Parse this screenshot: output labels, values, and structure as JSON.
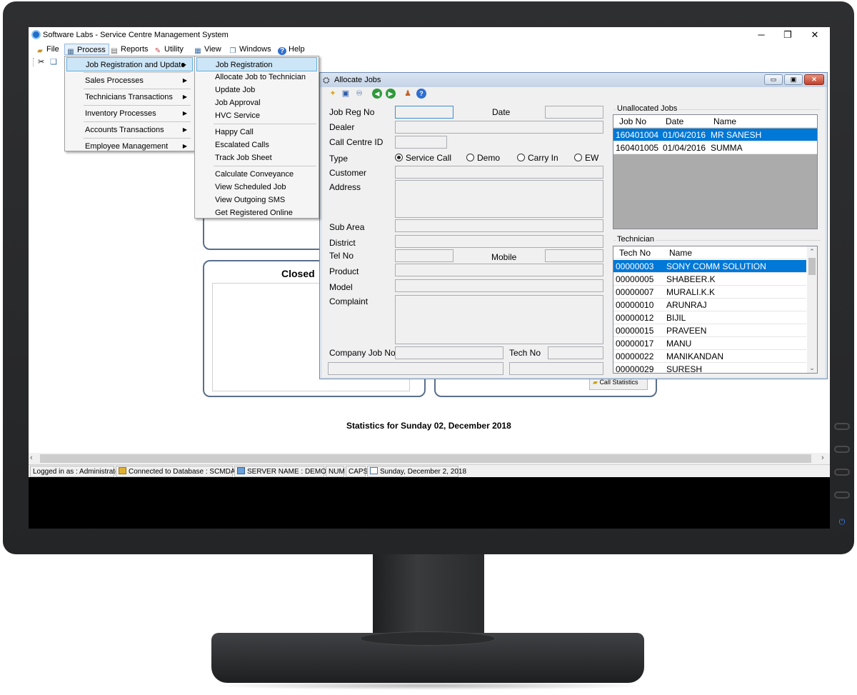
{
  "app": {
    "title": "Software Labs - Service Centre Management System",
    "controls": {
      "minimize": "─",
      "restore": "❐",
      "close": "✕"
    }
  },
  "menubar": {
    "items": [
      {
        "label": "File",
        "icon": "folder-icon"
      },
      {
        "label": "Process",
        "icon": "process-icon"
      },
      {
        "label": "Reports",
        "icon": "report-icon"
      },
      {
        "label": "Utility",
        "icon": "wrench-icon"
      },
      {
        "label": "View",
        "icon": "grid-icon"
      },
      {
        "label": "Windows",
        "icon": "windows-icon"
      },
      {
        "label": "Help",
        "icon": "help-icon"
      }
    ]
  },
  "process_menu": {
    "items": [
      {
        "label": "Job Registration and Update"
      },
      {
        "label": "Sales Processes"
      },
      {
        "label": "Technicians Transactions"
      },
      {
        "label": "Inventory Processes"
      },
      {
        "label": "Accounts Transactions"
      },
      {
        "label": "Employee Management"
      }
    ]
  },
  "submenu": {
    "items": [
      {
        "label": "Job Registration"
      },
      {
        "label": "Allocate Job to Technician"
      },
      {
        "label": "Update Job"
      },
      {
        "label": "Job Approval"
      },
      {
        "label": "HVC Service"
      },
      {
        "label": "Happy Call"
      },
      {
        "label": "Escalated Calls"
      },
      {
        "label": "Track Job Sheet"
      },
      {
        "label": "Calculate Conveyance"
      },
      {
        "label": "View Scheduled Job"
      },
      {
        "label": "View Outgoing SMS"
      },
      {
        "label": "Get Registered Online"
      }
    ]
  },
  "dashboard": {
    "closed_title": "Closed",
    "call_statistics": "Call Statistics",
    "stats_caption": "Statistics for Sunday 02, December 2018"
  },
  "allocate_jobs": {
    "title": "Allocate Jobs",
    "controls": {
      "minimize": "▭",
      "maximize": "▣",
      "close": "✕"
    },
    "labels": {
      "job_reg_no": "Job Reg No",
      "date": "Date",
      "dealer": "Dealer",
      "call_centre_id": "Call Centre ID",
      "type": "Type",
      "customer": "Customer",
      "address": "Address",
      "sub_area": "Sub Area",
      "district": "District",
      "tel_no": "Tel No",
      "mobile": "Mobile",
      "product": "Product",
      "model": "Model",
      "complaint": "Complaint",
      "company_job_no": "Company Job No",
      "tech_no": "Tech No"
    },
    "type_options": [
      {
        "label": "Service Call",
        "selected": true
      },
      {
        "label": "Demo",
        "selected": false
      },
      {
        "label": "Carry In",
        "selected": false
      },
      {
        "label": "EW",
        "selected": false
      }
    ],
    "unallocated": {
      "title": "Unallocated Jobs",
      "columns": [
        "Job No",
        "Date",
        "Name"
      ],
      "rows": [
        {
          "job_no": "160401004",
          "date": "01/04/2016",
          "name": "MR SANESH",
          "selected": true
        },
        {
          "job_no": "160401005",
          "date": "01/04/2016",
          "name": "SUMMA",
          "selected": false
        }
      ]
    },
    "technician": {
      "title": "Technician",
      "columns": [
        "Tech No",
        "Name"
      ],
      "rows": [
        {
          "tech_no": "00000003",
          "name": "SONY COMM SOLUTION",
          "selected": true
        },
        {
          "tech_no": "00000005",
          "name": "SHABEER.K",
          "selected": false
        },
        {
          "tech_no": "00000007",
          "name": "MURALI.K.K",
          "selected": false
        },
        {
          "tech_no": "00000010",
          "name": "ARUNRAJ",
          "selected": false
        },
        {
          "tech_no": "00000012",
          "name": "BIJIL",
          "selected": false
        },
        {
          "tech_no": "00000015",
          "name": "PRAVEEN",
          "selected": false
        },
        {
          "tech_no": "00000017",
          "name": "MANU",
          "selected": false
        },
        {
          "tech_no": "00000022",
          "name": "MANIKANDAN",
          "selected": false
        },
        {
          "tech_no": "00000029",
          "name": "SURESH",
          "selected": false
        }
      ]
    }
  },
  "statusbar": {
    "logged_in": "Logged in as : Administrator",
    "database": "Connected to Database : SCMDATA",
    "server": "SERVER NAME : DEMO-PC",
    "num": "NUM",
    "caps": "CAPS",
    "date": "Sunday, December 2, 2018"
  },
  "colors": {
    "selection": "#0078d7",
    "menu_highlight": "#cde6f7",
    "monitor": "#2b2c2e"
  }
}
